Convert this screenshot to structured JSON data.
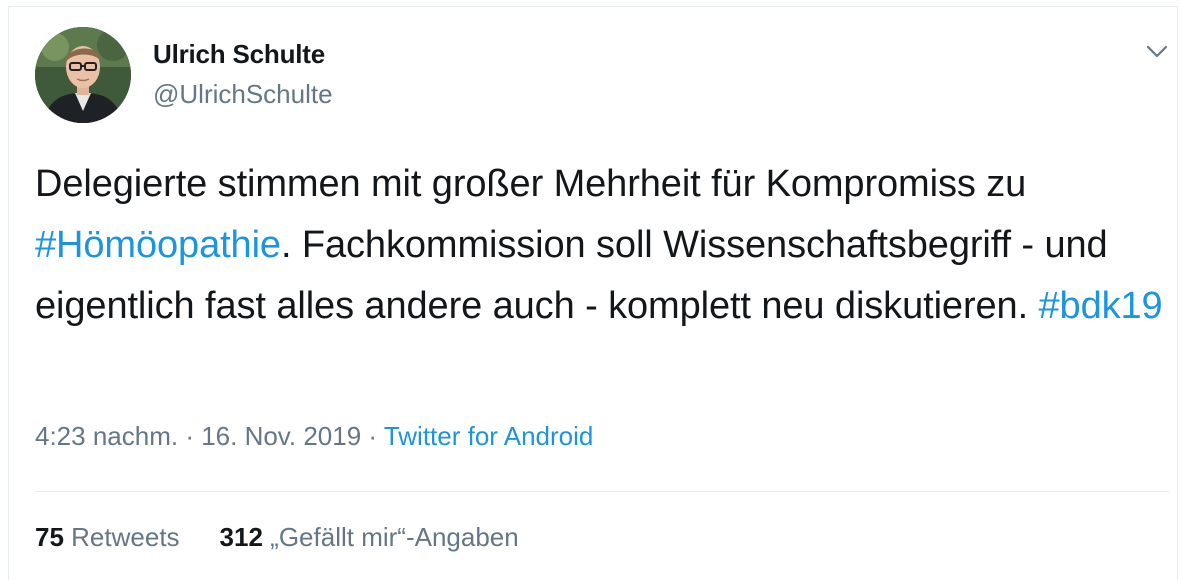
{
  "author": {
    "name": "Ulrich Schulte",
    "handle": "@UlrichSchulte"
  },
  "tweet": {
    "text_part1": "Delegierte stimmen mit großer Mehrheit für Kompromiss zu ",
    "hashtag1": "#Hömöopathie",
    "text_part2": ". Fachkommission soll Wissenschaftsbegriff - und eigentlich fast alles andere auch - komplett neu diskutieren. ",
    "hashtag2": "#bdk19"
  },
  "meta": {
    "time": "4:23 nachm.",
    "separator1": " · ",
    "date": "16. Nov. 2019",
    "separator2": " · ",
    "source": "Twitter for Android"
  },
  "stats": {
    "retweets_count": "75",
    "retweets_label": "Retweets",
    "likes_count": "312",
    "likes_label": "„Gefällt mir“-Angaben"
  },
  "icons": {
    "menu": "chevron-down-icon"
  },
  "colors": {
    "link": "#1b95e0",
    "secondary_text": "#657786",
    "primary_text": "#14171a",
    "border": "#e6ecf0"
  }
}
